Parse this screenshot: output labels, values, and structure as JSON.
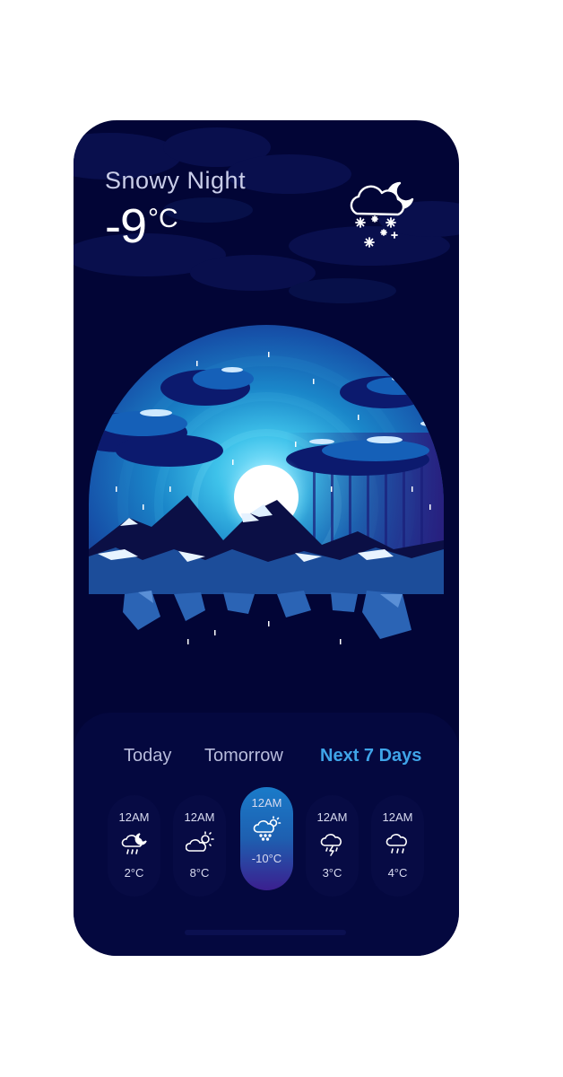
{
  "current": {
    "condition": "Snowy Night",
    "temperature": "-9",
    "unit": "°C",
    "icon": "cloud-moon-snow-icon"
  },
  "tabs": [
    {
      "label": "Today",
      "active": false
    },
    {
      "label": "Tomorrow",
      "active": false
    },
    {
      "label": "Next 7 Days",
      "active": true
    }
  ],
  "hourly": [
    {
      "time": "12AM",
      "icon": "cloud-moon-rain-icon",
      "temp": "2°C",
      "active": false
    },
    {
      "time": "12AM",
      "icon": "cloud-sun-icon",
      "temp": "8°C",
      "active": false
    },
    {
      "time": "12AM",
      "icon": "cloud-sun-snow-icon",
      "temp": "-10°C",
      "active": true
    },
    {
      "time": "12AM",
      "icon": "cloud-lightning-icon",
      "temp": "3°C",
      "active": false
    },
    {
      "time": "12AM",
      "icon": "cloud-rain-icon",
      "temp": "4°C",
      "active": false
    }
  ],
  "colors": {
    "background": "#020536",
    "panel": "#04083f",
    "accent": "#3fa4e8"
  }
}
